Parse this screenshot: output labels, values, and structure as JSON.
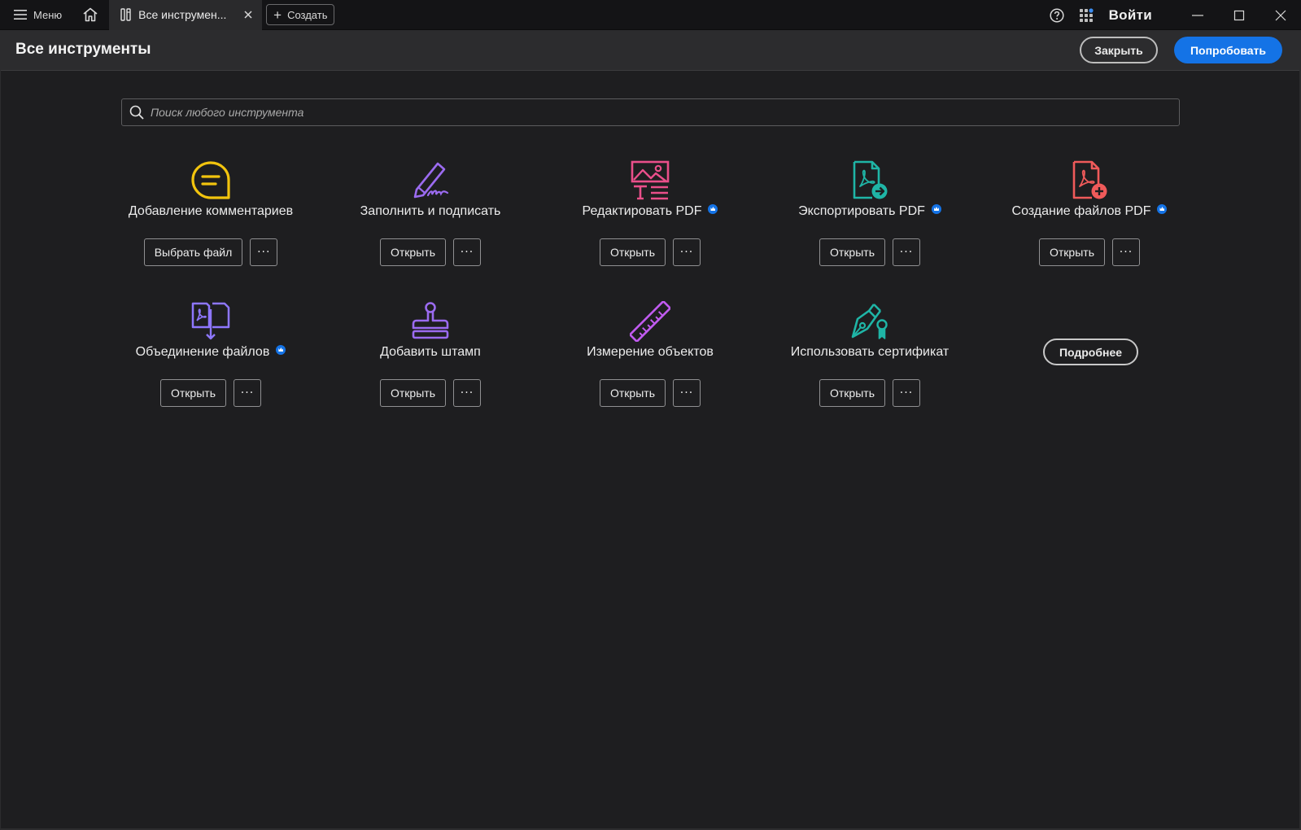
{
  "titlebar": {
    "menu_label": "Меню",
    "tab_label": "Все инструмен...",
    "new_label": "Создать",
    "signin_label": "Войти"
  },
  "header": {
    "title": "Все инструменты",
    "close_label": "Закрыть",
    "try_label": "Попробовать"
  },
  "search": {
    "placeholder": "Поиск любого инструмента",
    "value": ""
  },
  "colors": {
    "accent": "#1473e6",
    "comment": "#f2c40e",
    "fill_sign": "#9b6bf0",
    "edit": "#ea4f8a",
    "export": "#1fb5a6",
    "create": "#f05a5a",
    "combine": "#8e77ff",
    "stamp": "#9b6bf0",
    "measure": "#c15bf0",
    "certificate": "#1fb5a6"
  },
  "tools": [
    {
      "label": "Добавление комментариев",
      "action": "Выбрать файл",
      "more": "···",
      "icon": "comment-icon",
      "premium": false
    },
    {
      "label": "Заполнить и подписать",
      "action": "Открыть",
      "more": "···",
      "icon": "fill-sign-icon",
      "premium": false
    },
    {
      "label": "Редактировать PDF",
      "action": "Открыть",
      "more": "···",
      "icon": "edit-pdf-icon",
      "premium": true
    },
    {
      "label": "Экспортировать PDF",
      "action": "Открыть",
      "more": "···",
      "icon": "export-pdf-icon",
      "premium": true
    },
    {
      "label": "Создание файлов PDF",
      "action": "Открыть",
      "more": "···",
      "icon": "create-pdf-icon",
      "premium": true
    },
    {
      "label": "Объединение файлов",
      "action": "Открыть",
      "more": "···",
      "icon": "combine-files-icon",
      "premium": true
    },
    {
      "label": "Добавить штамп",
      "action": "Открыть",
      "more": "···",
      "icon": "stamp-icon",
      "premium": false
    },
    {
      "label": "Измерение объектов",
      "action": "Открыть",
      "more": "···",
      "icon": "measure-icon",
      "premium": false
    },
    {
      "label": "Использовать сертификат",
      "action": "Открыть",
      "more": "···",
      "icon": "certificate-icon",
      "premium": false
    }
  ],
  "more_link_label": "Подробнее"
}
